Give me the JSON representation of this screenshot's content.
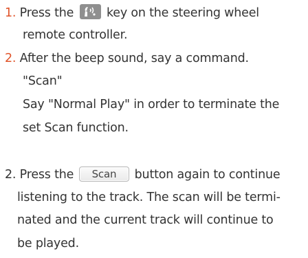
{
  "accent_color": "#e0542a",
  "text_color": "#333333",
  "step1": {
    "number": "1.",
    "before_icon": "Press the",
    "icon": "voice-recognition-icon",
    "after_icon": "key on the steering wheel",
    "line2": "remote controller."
  },
  "step2": {
    "number": "2.",
    "line1": "After the beep sound, say a command.",
    "command": "\"Scan\"",
    "note_line1": "Say \"Normal Play\" in order to terminate the",
    "note_line2": "set Scan function."
  },
  "alt_step": {
    "number": "2.",
    "before_button": "Press the",
    "button_label": "Scan",
    "after_button": "button again to continue",
    "line2": "listening to the track. The scan will be termi-",
    "line3": "nated and the current track will continue to",
    "line4": "be played."
  }
}
